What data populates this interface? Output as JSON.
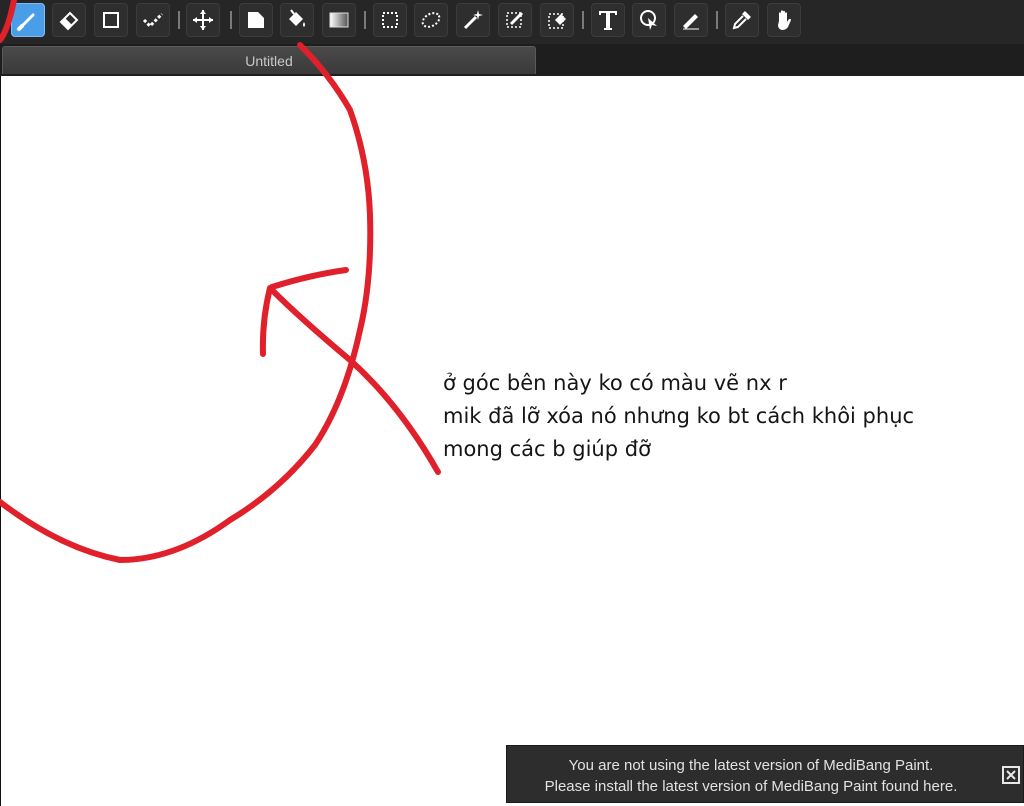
{
  "toolbar": {
    "tools": [
      {
        "name": "brush-tool",
        "icon": "brush-icon",
        "active": true
      },
      {
        "name": "eraser-tool",
        "icon": "eraser-icon"
      },
      {
        "name": "shape-tool",
        "icon": "square-icon"
      },
      {
        "name": "dot-tool",
        "icon": "dotted-line-icon"
      },
      {
        "name": "move-tool",
        "icon": "move-arrows-icon"
      },
      {
        "name": "fill-tool",
        "icon": "fill-square-icon"
      },
      {
        "name": "bucket-tool",
        "icon": "paint-bucket-icon"
      },
      {
        "name": "gradient-tool",
        "icon": "gradient-icon"
      },
      {
        "name": "select-tool",
        "icon": "rect-select-icon"
      },
      {
        "name": "lasso-tool",
        "icon": "lasso-icon"
      },
      {
        "name": "magic-wand-tool",
        "icon": "magic-wand-icon"
      },
      {
        "name": "select-pen-tool",
        "icon": "select-pen-icon"
      },
      {
        "name": "select-eraser-tool",
        "icon": "select-eraser-icon"
      },
      {
        "name": "text-tool",
        "icon": "text-T-icon"
      },
      {
        "name": "operation-tool",
        "icon": "pointer-icon"
      },
      {
        "name": "divide-tool",
        "icon": "pen-icon"
      },
      {
        "name": "eyedropper-tool",
        "icon": "eyedropper-icon"
      },
      {
        "name": "hand-tool",
        "icon": "hand-icon"
      }
    ]
  },
  "tab": {
    "title": "Untitled"
  },
  "note": {
    "lines": [
      "ở góc bên này ko có màu vẽ nx r",
      "mik đã lỡ xóa nó nhưng ko bt cách khôi phục",
      "mong các b giúp đỡ"
    ]
  },
  "update_notice": {
    "line1": "You are not using the latest version of MediBang Paint.",
    "line2": "Please install the latest version of MediBang Paint found here."
  },
  "colors": {
    "annotation": "#e0202a",
    "toolbar": "#262626",
    "active_tool": "#4a9ee8"
  }
}
